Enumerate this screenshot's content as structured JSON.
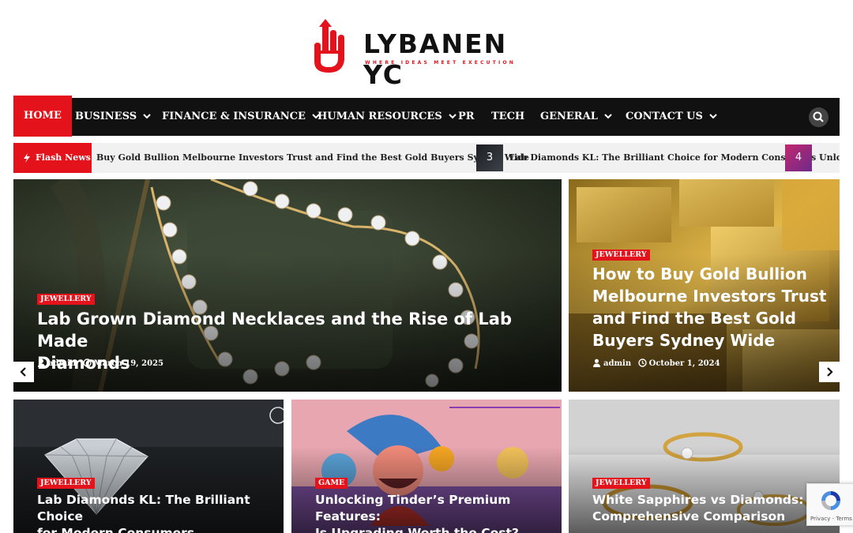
{
  "brand": {
    "name": "LYBANEN YC",
    "tagline": "WHERE IDEAS MEET EXECUTION",
    "accent": "#e4131b"
  },
  "nav": {
    "items": [
      {
        "label": "HOME",
        "active": true,
        "dropdown": false
      },
      {
        "label": "BUSINESS",
        "dropdown": true
      },
      {
        "label": "FINANCE & INSURANCE",
        "dropdown": true
      },
      {
        "label": "HUMAN RESOURCES",
        "dropdown": true
      },
      {
        "label": "PR",
        "dropdown": false
      },
      {
        "label": "TECH",
        "dropdown": false
      },
      {
        "label": "GENERAL",
        "dropdown": true
      },
      {
        "label": "CONTACT US",
        "dropdown": true
      }
    ],
    "search_icon": "search-icon"
  },
  "flash": {
    "label": "Flash News",
    "items": [
      {
        "text": "Buy Gold Bullion Melbourne Investors Trust and Find the Best Gold Buyers Sydney Wide"
      },
      {
        "number": "3",
        "text": "Lab Diamonds KL: The Brilliant Choice for Modern Consumers"
      },
      {
        "number": "4",
        "text": "Unlo"
      }
    ]
  },
  "featured": {
    "main": {
      "category": "JEWELLERY",
      "title_line1": "Lab Grown Diamond Necklaces and the Rise of Lab Made",
      "title_line2": "Diamonds",
      "author": "admin",
      "date": "March 19, 2025"
    },
    "side": {
      "category": "JEWELLERY",
      "title_lines": [
        "How to Buy Gold Bullion",
        "Melbourne Investors Trust",
        "and Find the Best Gold",
        "Buyers Sydney Wide"
      ],
      "author": "admin",
      "date": "October 1, 2024"
    }
  },
  "cards": [
    {
      "category": "JEWELLERY",
      "title_line1": "Lab Diamonds KL: The Brilliant Choice",
      "title_line2": "for Modern Consumers"
    },
    {
      "category": "GAME",
      "title_line1": "Unlocking Tinder’s Premium Features:",
      "title_line2": "Is Upgrading Worth the Cost?"
    },
    {
      "category": "JEWELLERY",
      "title_line1": "White Sapphires vs Diamonds: A",
      "title_line2": "Comprehensive Comparison"
    }
  ],
  "recaptcha": {
    "footer": "Privacy - Terms"
  }
}
